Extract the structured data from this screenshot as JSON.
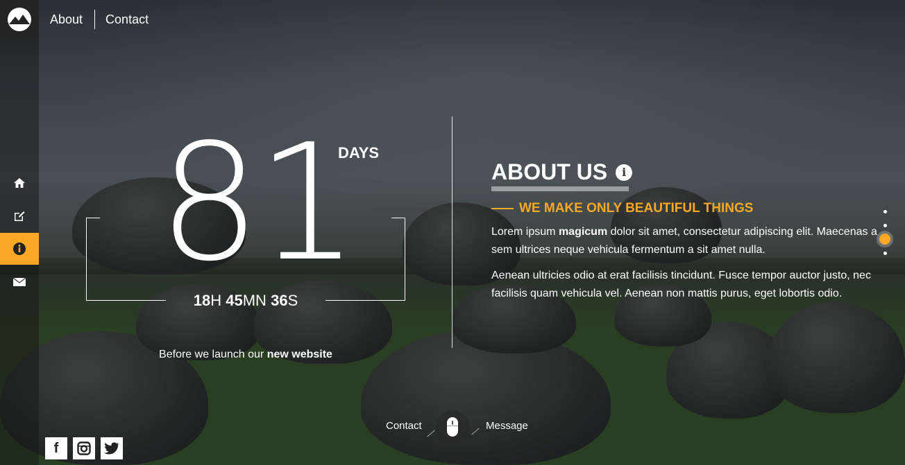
{
  "nav": {
    "items": [
      {
        "label": "About"
      },
      {
        "label": "Contact"
      }
    ]
  },
  "sidebar": {
    "items": [
      {
        "icon": "home-icon"
      },
      {
        "icon": "edit-icon"
      },
      {
        "icon": "info-icon",
        "active": true
      },
      {
        "icon": "mail-icon"
      }
    ]
  },
  "countdown": {
    "days_value": "81",
    "days_label": "DAYS",
    "hours": "18",
    "hours_unit": "H",
    "minutes": "45",
    "minutes_unit": "MN",
    "seconds": "36",
    "seconds_unit": "S",
    "launch_prefix": "Before we launch our",
    "launch_bold": "new website"
  },
  "about": {
    "title": "ABOUT US",
    "tagline": "WE MAKE ONLY BEAUTIFUL THINGS",
    "p1_before": "Lorem ipsum",
    "p1_bold": "magicum",
    "p1_after": "dolor sit amet, consectetur adipiscing elit. Maecenas a sem ultrices neque vehicula fermentum a sit amet nulla.",
    "p2": "Aenean ultricies odio at erat facilisis tincidunt. Fusce tempor auctor justo, nec facilisis quam vehicula vel. Aenean non mattis purus, eget lobortis odio."
  },
  "bottom": {
    "contact_label": "Contact",
    "message_label": "Message"
  },
  "social": [
    {
      "icon": "facebook-icon",
      "glyph": "f"
    },
    {
      "icon": "instagram-icon",
      "glyph": ""
    },
    {
      "icon": "twitter-icon",
      "glyph": ""
    }
  ],
  "colors": {
    "accent": "#f9a825",
    "logo_bg": "#242424"
  }
}
